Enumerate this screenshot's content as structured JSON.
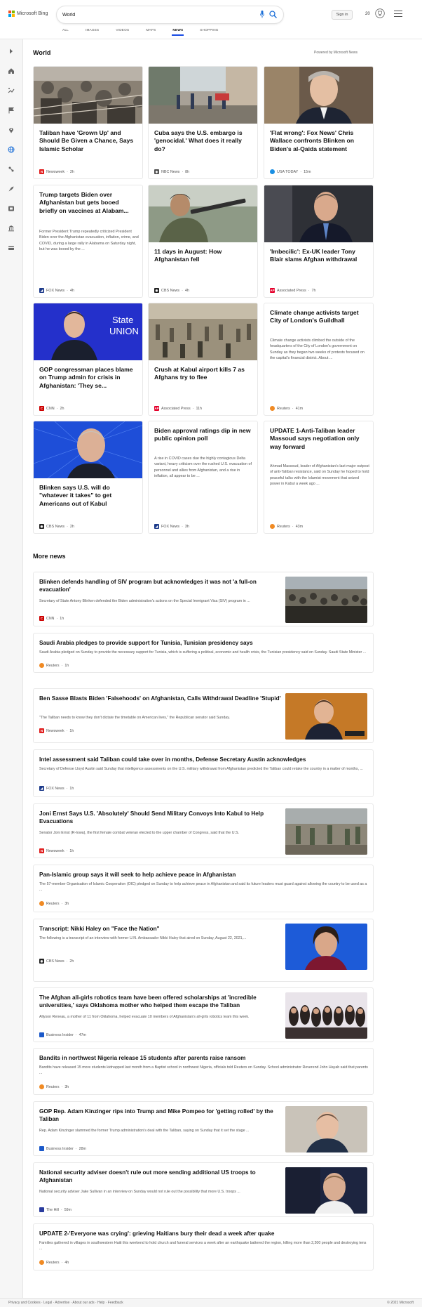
{
  "header": {
    "brand": "Microsoft Bing",
    "search_value": "World",
    "signin_label": "Sign in",
    "rewards_count": "20",
    "tabs": [
      "ALL",
      "IMAGES",
      "VIDEOS",
      "MAPS",
      "NEWS",
      "SHOPPING"
    ],
    "active_tab": "NEWS"
  },
  "colors": {
    "accent": "#174ae4",
    "logo_red": "#f25022",
    "logo_green": "#7fba00",
    "logo_blue": "#00a4ef",
    "logo_yellow": "#ffb900"
  },
  "world": {
    "title": "World",
    "powered_by": "Powered by Microsoft News",
    "cards": [
      {
        "title": "Taliban have 'Grown Up' and Should Be Given a Chance, Says Islamic Scholar",
        "snippet": "",
        "source": "Newsweek",
        "time": "2h",
        "image": "crowd-photo"
      },
      {
        "title": "Cuba says the U.S. embargo is 'genocidal.' What does it really do?",
        "snippet": "",
        "source": "NBC News",
        "time": "8h",
        "image": "street-photo"
      },
      {
        "title": "'Flat wrong': Fox News' Chris Wallace confronts Blinken on Biden's al-Qaida statement",
        "snippet": "",
        "source": "USA TODAY",
        "time": "15m",
        "image": "portrait-photo"
      },
      {
        "title": "Trump targets Biden over Afghanistan but gets booed briefly on vaccines at Alabam...",
        "snippet": "Former President Trump repeatedly criticized President Biden over the Afghanistan evacuation, inflation, crime, and COVID, during a large rally in Alabama on Saturday night, but he was booed by the ...",
        "source": "FOX News",
        "time": "4h",
        "image": ""
      },
      {
        "title": "11 days in August: How Afghanistan fell",
        "snippet": "",
        "source": "CBS News",
        "time": "4h",
        "image": "soldier-photo"
      },
      {
        "title": "'Imbecilic': Ex-UK leader Tony Blair slams Afghan withdrawal",
        "snippet": "",
        "source": "Associated Press",
        "time": "7h",
        "image": "blair-photo"
      },
      {
        "title": "GOP congressman places blame on Trump admin for crisis in Afghanistan: 'They se...",
        "snippet": "",
        "source": "CNN",
        "time": "2h",
        "image": "state-union-photo"
      },
      {
        "title": "Crush at Kabul airport kills 7 as Afghans try to flee",
        "snippet": "",
        "source": "Associated Press",
        "time": "11h",
        "image": "airport-photo"
      },
      {
        "title": "Climate change activists target City of London's Guildhall",
        "snippet": "Climate change activists climbed the outside of the headquarters of the City of London's government on Sunday as they began two weeks of protests focused on the capital's financial district. About ...",
        "source": "Reuters",
        "time": "41m",
        "image": ""
      },
      {
        "title": "Blinken says U.S. will do \"whatever it takes\" to get Americans out of Kabul",
        "snippet": "",
        "source": "CBS News",
        "time": "2h",
        "image": "blinken-photo"
      },
      {
        "title": "Biden approval ratings dip in new public opinion poll",
        "snippet": "A rise in COVID cases due the highly contagious Delta variant, heavy criticism over the rushed U.S. evacuation of personnel and allies from Afghanistan, and a rise in inflation, all appear to be ...",
        "source": "FOX News",
        "time": "3h",
        "image": ""
      },
      {
        "title": "UPDATE 1-Anti-Taliban leader Massoud says negotiation only way forward",
        "snippet": "Ahmad Massoud, leader of Afghanistan's last major outpost of anti-Taliban resistance, said on Sunday he hoped to hold peaceful talks with the Islamist movement that seized power in Kabul a week ago ...",
        "source": "Reuters",
        "time": "43m",
        "image": ""
      }
    ]
  },
  "more_news": {
    "title": "More news",
    "items": [
      {
        "title": "Blinken defends handling of SIV program but acknowledges it was not 'a full-on evacuation'",
        "snippet": "Secretary of State Antony Blinken defended the Biden administration's actions on the Special Immigrant Visa (SIV) program in ...",
        "source": "CNN",
        "time": "1h",
        "thumb": true
      },
      {
        "title": "Saudi Arabia pledges to provide support for Tunisia, Tunisian presidency says",
        "snippet": "Saudi Arabia pledged on Sunday to provide the necessary support for Tunisia, which is suffering a political, economic and health crisis, the Tunisian presidency said on Sunday. Saudi State Minister ...",
        "source": "Reuters",
        "time": "1h",
        "thumb": false
      },
      {
        "title": "Ben Sasse Blasts Biden 'Falsehoods' on Afghanistan, Calls Withdrawal Deadline 'Stupid'",
        "snippet": "\"The Taliban needs to know they don't dictate the timetable on American lives,\" the Republican senator said Sunday.",
        "source": "Newsweek",
        "time": "1h",
        "thumb": true
      },
      {
        "title": "Intel assessment said Taliban could take over in months, Defense Secretary Austin acknowledges",
        "snippet": "Secretary of Defense Lloyd Austin said Sunday that intelligence assessments on the U.S. military withdrawal from Afghanistan predicted the Taliban could retake the country in a matter of months, ...",
        "source": "FOX News",
        "time": "1h",
        "thumb": false
      },
      {
        "title": "Joni Ernst Says U.S. 'Absolutely' Should Send Military Convoys Into Kabul to Help Evacuations",
        "snippet": "Senator Joni Ernst (R-Iowa), the first female combat veteran elected to the upper chamber of Congress, said that the U.S.",
        "source": "Newsweek",
        "time": "1h",
        "thumb": true
      },
      {
        "title": "Pan-Islamic group says it will seek to help achieve peace in Afghanistan",
        "snippet": "The 57-member Organisation of Islamic Cooperation (OIC) pledged on Sunday to help achieve peace in Afghanistan and said its future leaders must guard against allowing the country to be used as a ...",
        "source": "Reuters",
        "time": "3h",
        "thumb": false
      },
      {
        "title": "Transcript: Nikki Haley on \"Face the Nation\"",
        "snippet": "The following is a transcript of an interview with former U.N. Ambassador Nikki Haley that aired on Sunday, August 22, 2021,...",
        "source": "CBS News",
        "time": "2h",
        "thumb": true
      },
      {
        "title": "The Afghan all-girls robotics team have been offered scholarships at 'incredible universities,' says Oklahoma mother who helped them escape the Taliban",
        "snippet": "Allyson Reneau, a mother of 11 from Oklahoma, helped evacuate 10 members of Afghanistan's all-girls robotics team this week.",
        "source": "Business Insider",
        "time": "47m",
        "thumb": true
      },
      {
        "title": "Bandits in northwest Nigeria release 15 students after parents raise ransom",
        "snippet": "Bandits have released 15 more students kidnapped last month from a Baptist school in northwest Nigeria, officials told Reuters on Sunday. School administrator Reverend John Hayab said that parents ...",
        "source": "Reuters",
        "time": "3h",
        "thumb": false
      },
      {
        "title": "GOP Rep. Adam Kinzinger rips into Trump and Mike Pompeo for 'getting rolled' by the Taliban",
        "snippet": "Rep. Adam Kinzinger slammed the former Trump administration's deal with the Taliban, saying on Sunday that it set the stage ...",
        "source": "Business Insider",
        "time": "28m",
        "thumb": true
      },
      {
        "title": "National security adviser doesn't rule out more sending additional US troops to Afghanistan",
        "snippet": "National security adviser Jake Sullivan in an interview on Sunday would not rule out the possibility that more U.S. troops ...",
        "source": "The Hill",
        "time": "59m",
        "thumb": true
      },
      {
        "title": "UPDATE 2-'Everyone was crying': grieving Haitians bury their dead a week after quake",
        "snippet": "Families gathered in villages in southwestern Haiti this weekend to hold church and funeral services a week after an earthquake battered the region, killing more than 2,200 people and destroying tens ...",
        "source": "Reuters",
        "time": "4h",
        "thumb": false
      }
    ]
  },
  "footer": {
    "left": "Privacy and Cookies · Legal · Advertise · About our ads · Help · Feedback",
    "right": "© 2021 Microsoft"
  }
}
